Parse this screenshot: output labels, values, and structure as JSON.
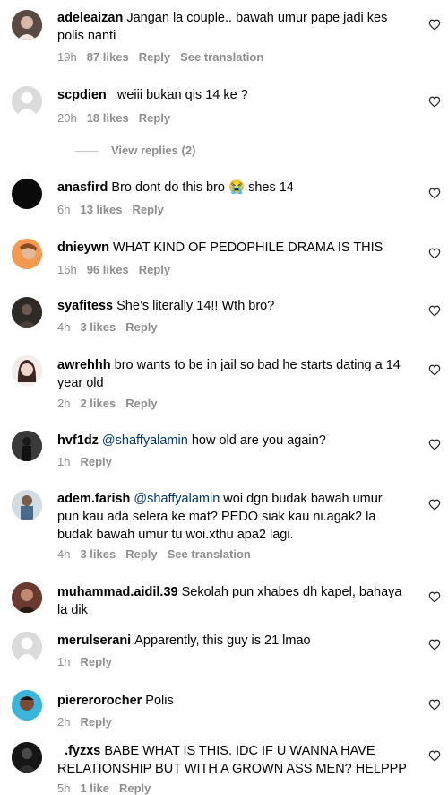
{
  "comments": [
    {
      "user": "adeleaizan",
      "text": "Jangan la couple.. bawah umur pape jadi kes polis nanti",
      "time": "19h",
      "likes": "87 likes",
      "reply": "Reply",
      "translate": "See translation"
    },
    {
      "user": "scpdien_",
      "text": "weiii bukan qis 14 ke ?",
      "time": "20h",
      "likes": "18 likes",
      "reply": "Reply"
    },
    {
      "user": "anasfird",
      "text": "Bro dont do this bro 😭 shes 14",
      "time": "6h",
      "likes": "13 likes",
      "reply": "Reply"
    },
    {
      "user": "dnieywn",
      "text": "WHAT KIND OF PEDOPHILE DRAMA IS THIS",
      "time": "16h",
      "likes": "96 likes",
      "reply": "Reply"
    },
    {
      "user": "syafitess",
      "text": "She’s literally 14!! Wth bro?",
      "time": "4h",
      "likes": "3 likes",
      "reply": "Reply"
    },
    {
      "user": "awrehhh",
      "text": "bro wants to be in jail so bad he starts dating a 14 year old",
      "time": "2h",
      "likes": "2 likes",
      "reply": "Reply"
    },
    {
      "user": "hvf1dz",
      "mention": "@shaffyalamin",
      "text": "how old are you again?",
      "time": "1h",
      "reply": "Reply"
    },
    {
      "user": "adem.farish",
      "mention": "@shaffyalamin",
      "text": "woi dgn budak bawah umur pun kau ada selera ke mat? PEDO siak kau ni.agak2 la budak bawah umur tu woi.xthu apa2 lagi.",
      "time": "4h",
      "likes": "3 likes",
      "reply": "Reply",
      "translate": "See translation"
    },
    {
      "user": "muhammad.aidil.39",
      "text": "Sekolah pun xhabes dh kapel, bahaya la dik"
    },
    {
      "user": "merulserani",
      "text": "Apparently, this guy is 21 lmao",
      "time": "1h",
      "reply": "Reply"
    },
    {
      "user": "piererorocher",
      "text": "Polis",
      "time": "2h",
      "reply": "Reply"
    },
    {
      "user": "_.fyzxs",
      "text": "BABE WHAT IS THIS. IDC IF U WANNA HAVE RELATIONSHIP BUT WITH A GROWN ASS MEN? HELPPP",
      "time": "5h",
      "likes": "1 like",
      "reply": "Reply"
    }
  ],
  "view_replies": "View replies (2)",
  "colors": {
    "meta": "#8e8e8e",
    "mention": "#00376b",
    "line": "#c7c7c7"
  }
}
